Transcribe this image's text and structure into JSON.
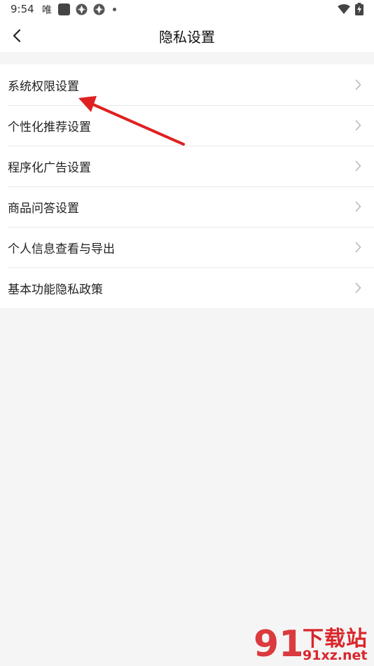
{
  "status_bar": {
    "time": "9:54",
    "app_glyph": "唯",
    "icons": [
      "app-square-icon",
      "aperture-icon",
      "aperture-icon",
      "dot-icon",
      "wifi-icon",
      "battery-charging-icon"
    ]
  },
  "header": {
    "back_icon": "chevron-left-icon",
    "title": "隐私设置"
  },
  "settings": {
    "items": [
      {
        "label": "系统权限设置"
      },
      {
        "label": "个性化推荐设置"
      },
      {
        "label": "程序化广告设置"
      },
      {
        "label": "商品问答设置"
      },
      {
        "label": "个人信息查看与导出"
      },
      {
        "label": "基本功能隐私政策"
      }
    ],
    "chevron_icon": "chevron-right-icon"
  },
  "annotation": {
    "color": "#e02020",
    "target": "系统权限设置"
  },
  "watermark": {
    "logo_text": "91",
    "main_text": "下载站",
    "sub_text": "91xz.net",
    "color": "#d9262b"
  },
  "colors": {
    "background": "#f5f5f5",
    "card": "#ffffff",
    "text": "#222222",
    "divider": "#e8e8e8",
    "chevron": "#b8b8b8"
  }
}
